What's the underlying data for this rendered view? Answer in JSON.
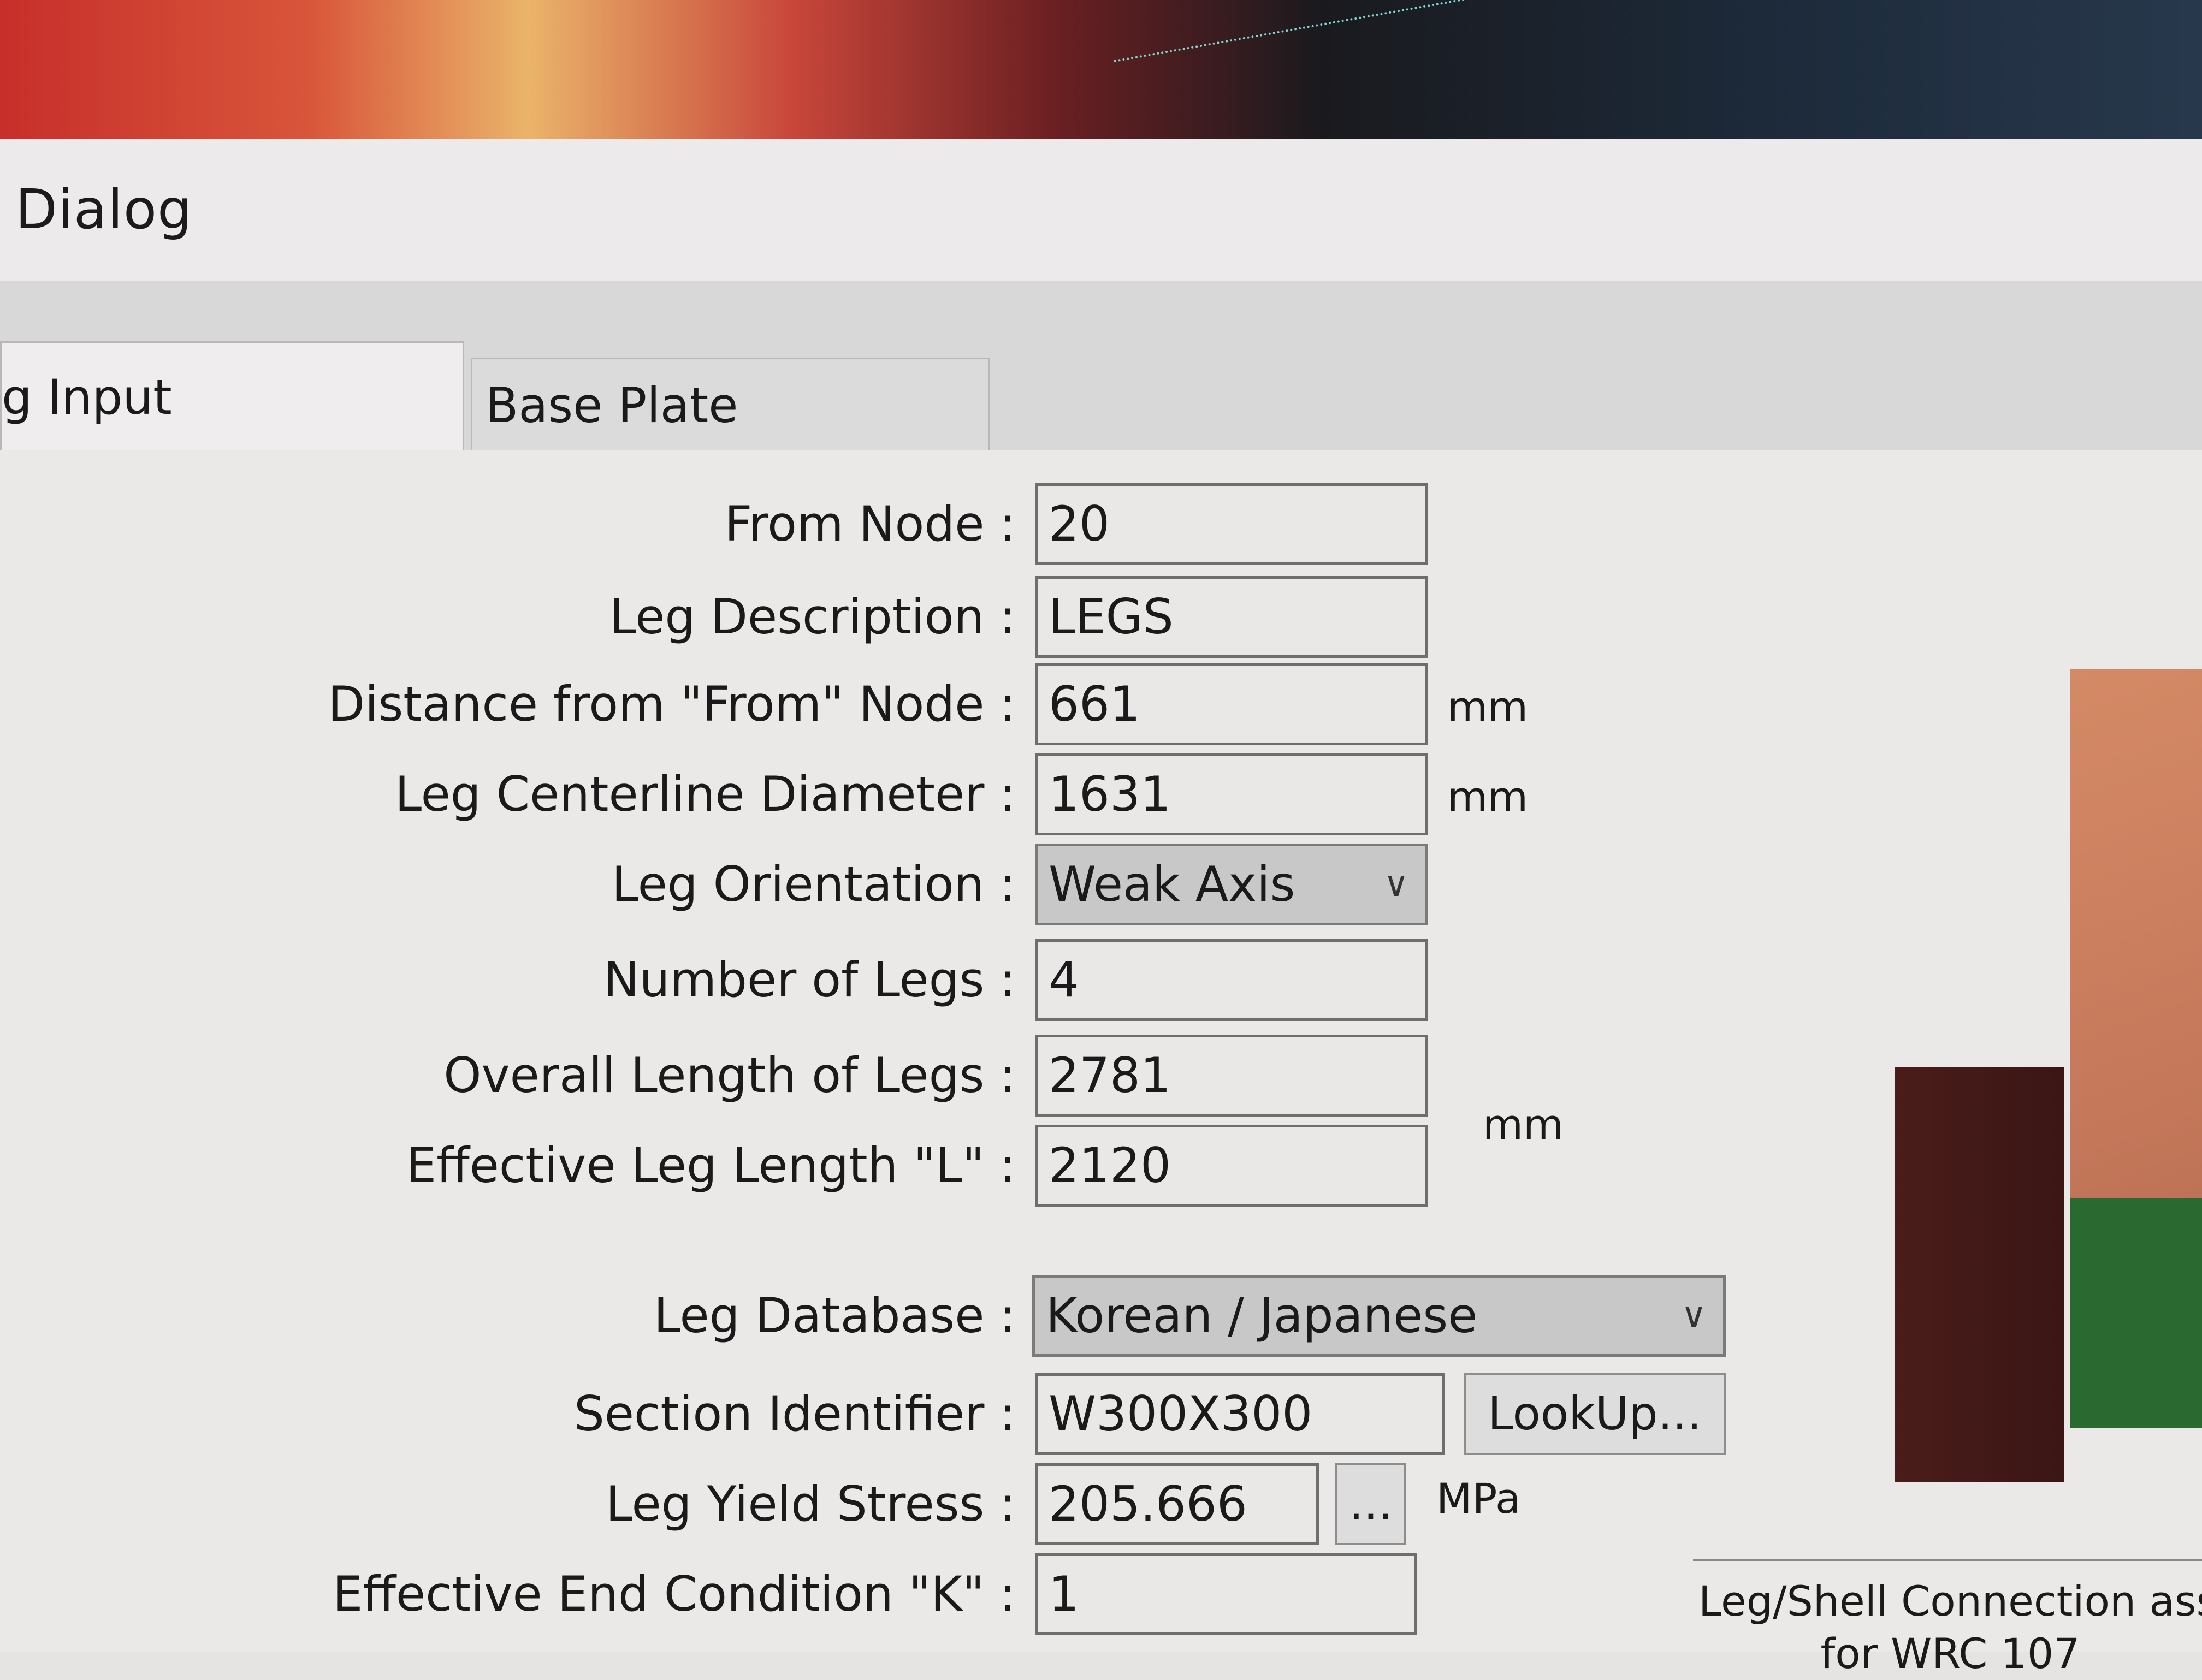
{
  "dialog": {
    "title": "Dialog"
  },
  "tabs": [
    {
      "label": "g Input Parameters",
      "active": true
    },
    {
      "label": "Base Plate Parameters",
      "active": false
    }
  ],
  "form": {
    "from_node": {
      "label": "From Node :",
      "value": "20"
    },
    "leg_description": {
      "label": "Leg Description :",
      "value": "LEGS"
    },
    "distance_from_node": {
      "label": "Distance from \"From\" Node :",
      "value": "661",
      "unit": "mm"
    },
    "centerline_diameter": {
      "label": "Leg Centerline Diameter :",
      "value": "1631",
      "unit": "mm"
    },
    "leg_orientation": {
      "label": "Leg Orientation :",
      "value": "Weak Axis"
    },
    "number_of_legs": {
      "label": "Number of Legs :",
      "value": "4"
    },
    "overall_length": {
      "label": "Overall Length of Legs :",
      "value": "2781"
    },
    "effective_length": {
      "label": "Effective Leg Length \"L\" :",
      "value": "2120"
    },
    "length_unit": "mm",
    "leg_database": {
      "label": "Leg Database :",
      "value": "Korean / Japanese"
    },
    "section_identifier": {
      "label": "Section Identifier :",
      "value": "W300X300",
      "button": "LookUp..."
    },
    "yield_stress": {
      "label": "Leg Yield Stress :",
      "value": "205.666",
      "button": "...",
      "unit": "MPa"
    },
    "end_condition": {
      "label": "Effective End Condition \"K\" :",
      "value": "1"
    }
  },
  "side_note": {
    "line1": "Leg/Shell Connection assum",
    "line2": "for WRC 107"
  },
  "colors": {
    "window_bg": "#e8e6e4",
    "field_border": "#6e6e6e",
    "select_bg": "#c9c8c8"
  }
}
